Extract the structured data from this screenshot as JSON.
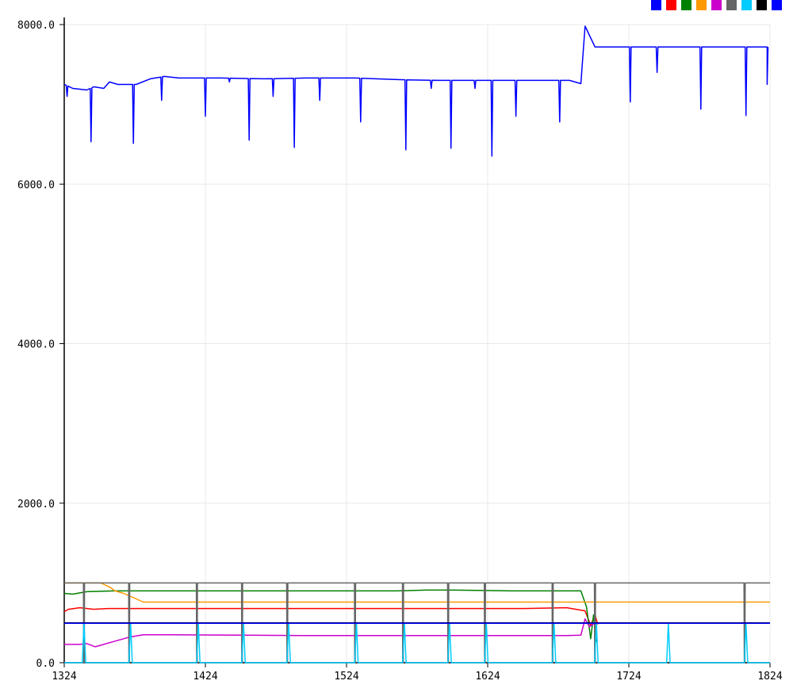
{
  "chart_data": {
    "type": "line",
    "x_ticks": [
      "1324",
      "1424",
      "1524",
      "1624",
      "1724",
      "1824"
    ],
    "y_ticks": [
      "0.0",
      "2000.0",
      "4000.0",
      "6000.0",
      "8000.0"
    ],
    "xlim": [
      1324,
      1824
    ],
    "ylim": [
      0,
      8000
    ],
    "grid": true,
    "legend_placement": "top-right",
    "legend_colors": [
      "#0000ff",
      "#ff0000",
      "#008000",
      "#ff9900",
      "#cc00cc",
      "#666666",
      "#00ccff",
      "#000000",
      "#0000ff"
    ],
    "series": [
      {
        "color": "#0000ff",
        "baseline_segments": [
          {
            "x": [
              1324,
              1330,
              1340,
              1345,
              1352,
              1356,
              1362,
              1375,
              1385,
              1395,
              1405,
              1435,
              1465,
              1495,
              1530,
              1560,
              1590,
              1620,
              1650,
              1682,
              1690,
              1693,
              1700,
              1715,
              1730,
              1745,
              1760,
              1790,
              1810,
              1820,
              1822
            ],
            "y": [
              7250,
              7200,
              7180,
              7220,
              7200,
              7280,
              7250,
              7250,
              7320,
              7350,
              7330,
              7330,
              7320,
              7330,
              7330,
              7310,
              7300,
              7300,
              7300,
              7300,
              7260,
              7980,
              7720,
              7720,
              7720,
              7720,
              7720,
              7720,
              7720,
              7720,
              7720
            ]
          }
        ],
        "dips": [
          {
            "x": 1326,
            "y": 7100
          },
          {
            "x": 1343,
            "y": 6530
          },
          {
            "x": 1373,
            "y": 6510
          },
          {
            "x": 1393,
            "y": 7050
          },
          {
            "x": 1424,
            "y": 6850
          },
          {
            "x": 1441,
            "y": 7280
          },
          {
            "x": 1455,
            "y": 6550
          },
          {
            "x": 1472,
            "y": 7100
          },
          {
            "x": 1487,
            "y": 6460
          },
          {
            "x": 1505,
            "y": 7050
          },
          {
            "x": 1534,
            "y": 6780
          },
          {
            "x": 1566,
            "y": 6430
          },
          {
            "x": 1584,
            "y": 7200
          },
          {
            "x": 1598,
            "y": 6450
          },
          {
            "x": 1615,
            "y": 7200
          },
          {
            "x": 1627,
            "y": 6350
          },
          {
            "x": 1644,
            "y": 6850
          },
          {
            "x": 1675,
            "y": 6780
          },
          {
            "x": 1725,
            "y": 7030
          },
          {
            "x": 1744,
            "y": 7400
          },
          {
            "x": 1775,
            "y": 6940
          },
          {
            "x": 1807,
            "y": 6860
          },
          {
            "x": 1822,
            "y": 7250
          }
        ]
      },
      {
        "color": "#ff0000",
        "x": [
          1324,
          1327,
          1335,
          1345,
          1355,
          1400,
          1450,
          1500,
          1550,
          1600,
          1650,
          1680,
          1693,
          1697,
          1700,
          1702
        ],
        "y": [
          640,
          670,
          690,
          670,
          680,
          680,
          680,
          680,
          680,
          680,
          680,
          690,
          650,
          470,
          600,
          480
        ]
      },
      {
        "color": "#008000",
        "x": [
          1324,
          1330,
          1340,
          1360,
          1380,
          1420,
          1470,
          1520,
          1560,
          1580,
          1600,
          1640,
          1690,
          1694,
          1697,
          1699,
          1701
        ],
        "y": [
          870,
          860,
          890,
          900,
          900,
          900,
          900,
          900,
          900,
          910,
          910,
          900,
          900,
          700,
          300,
          600,
          260
        ]
      },
      {
        "color": "#ff9900",
        "x": [
          1324,
          1350,
          1356,
          1360,
          1366,
          1375,
          1380,
          1400,
          1450,
          1500,
          1550,
          1600,
          1650,
          1700,
          1750,
          1824
        ],
        "y": [
          1000,
          1000,
          950,
          900,
          870,
          800,
          760,
          760,
          760,
          760,
          760,
          760,
          760,
          760,
          760,
          760
        ]
      },
      {
        "color": "#cc00cc",
        "x": [
          1324,
          1335,
          1340,
          1346,
          1352,
          1360,
          1370,
          1380,
          1400,
          1450,
          1500,
          1550,
          1600,
          1650,
          1680,
          1690,
          1693,
          1696,
          1700
        ],
        "y": [
          230,
          230,
          240,
          200,
          230,
          270,
          320,
          350,
          350,
          345,
          340,
          340,
          340,
          340,
          340,
          345,
          550,
          450,
          500
        ]
      },
      {
        "color": "#666666",
        "high": 1000,
        "low": 0,
        "drops": [
          1338,
          1370,
          1418,
          1450,
          1482,
          1530,
          1564,
          1596,
          1622,
          1670,
          1700,
          1806
        ]
      },
      {
        "color": "#00ccff",
        "baseline": 0,
        "spikes": [
          {
            "x": 1338,
            "y": 500
          },
          {
            "x": 1371,
            "y": 500
          },
          {
            "x": 1419,
            "y": 500
          },
          {
            "x": 1451,
            "y": 500
          },
          {
            "x": 1483,
            "y": 500
          },
          {
            "x": 1531,
            "y": 500
          },
          {
            "x": 1565,
            "y": 500
          },
          {
            "x": 1597,
            "y": 500
          },
          {
            "x": 1623,
            "y": 500
          },
          {
            "x": 1671,
            "y": 500
          },
          {
            "x": 1701,
            "y": 500
          },
          {
            "x": 1752,
            "y": 500
          },
          {
            "x": 1807,
            "y": 500
          }
        ]
      },
      {
        "color": "#000000",
        "x": [
          1324,
          1824
        ],
        "y": [
          500,
          500
        ]
      },
      {
        "color": "#0000ff",
        "x": [
          1324,
          1824
        ],
        "y": [
          495,
          495
        ]
      }
    ]
  }
}
